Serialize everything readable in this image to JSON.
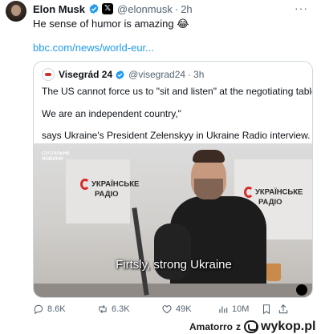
{
  "post": {
    "author_name": "Elon Musk",
    "author_handle": "@elonmusk",
    "separator": "·",
    "time": "2h",
    "more": "···",
    "text": "He sense of humor is amazing 😂",
    "link": "bbc.com/news/world-eur..."
  },
  "quote": {
    "author_name": "Visegrád 24",
    "author_handle": "@visegrad24",
    "separator": "·",
    "time": "3h",
    "lines": [
      "The US cannot force us to \"sit and listen\" at the negotiating table.",
      "We are an independent country,\"",
      "says Ukraine's President Zelenskyy in Ukraine Radio interview."
    ],
    "video": {
      "subtitle": "Firtsly, strong Ukraine",
      "sign_left": [
        "УКРАЇНСЬКЕ",
        "РАДІО"
      ],
      "sign_right": [
        "УКРАЇНСЬКЕ",
        "РАДІО"
      ],
      "channel_logo": [
        "СУСПІЛЬНЕ",
        "НОВИНИ"
      ]
    }
  },
  "actions": {
    "replies": "8.6K",
    "reposts": "6.3K",
    "likes": "49K",
    "views": "10M"
  },
  "watermark": {
    "user": "Amatorro",
    "z": "z",
    "site": "wykop.pl"
  },
  "colors": {
    "verified": "#1d9bf0",
    "link": "#1d9bf0",
    "muted": "#536471",
    "border": "#cfd9de"
  },
  "icons": [
    "verified-badge-icon",
    "x-premium-icon",
    "more-icon",
    "reply-icon",
    "repost-icon",
    "like-icon",
    "views-icon",
    "bookmark-icon",
    "share-icon"
  ]
}
